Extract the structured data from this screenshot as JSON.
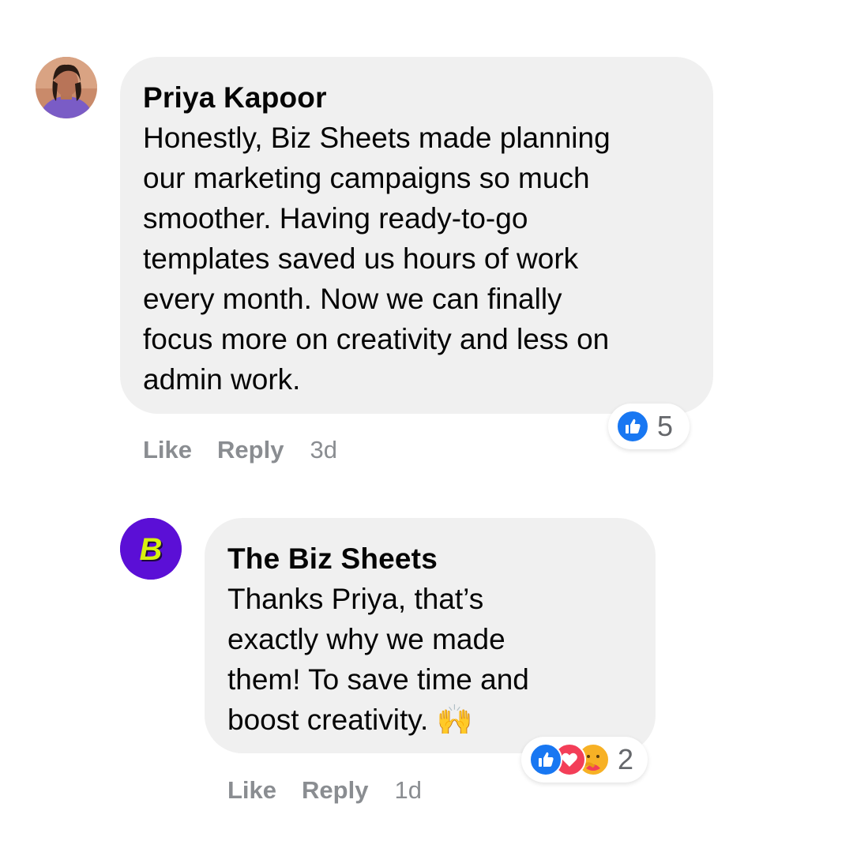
{
  "comments": [
    {
      "author": "Priya Kapoor",
      "lines": [
        "Honestly, Biz Sheets made planning",
        "our marketing campaigns so much",
        "smoother. Having ready-to-go",
        "templates saved us hours of work",
        "every month. Now we can finally",
        "focus more on creativity and less on",
        "admin work."
      ],
      "actions": {
        "like": "Like",
        "reply": "Reply",
        "time": "3d"
      },
      "reactions": {
        "icons": [
          "like-icon"
        ],
        "count": "5"
      },
      "avatar_icon": "person-avatar"
    },
    {
      "author": "The Biz Sheets",
      "lines": [
        "Thanks Priya, that’s",
        "exactly why we made",
        "them! To save time and",
        "boost creativity. 🙌"
      ],
      "actions": {
        "like": "Like",
        "reply": "Reply",
        "time": "1d"
      },
      "reactions": {
        "icons": [
          "like-icon",
          "love-icon",
          "care-icon"
        ],
        "count": "2"
      },
      "avatar_icon": "biz-sheets-logo",
      "avatar_letter": "B"
    }
  ],
  "colors": {
    "bubble": "#f0f0f0",
    "like_blue": "#1877f2",
    "love_red": "#f33e58",
    "logo_purple": "#5b0fd6",
    "logo_yellow": "#d7f20f",
    "muted": "#8a8d91"
  }
}
